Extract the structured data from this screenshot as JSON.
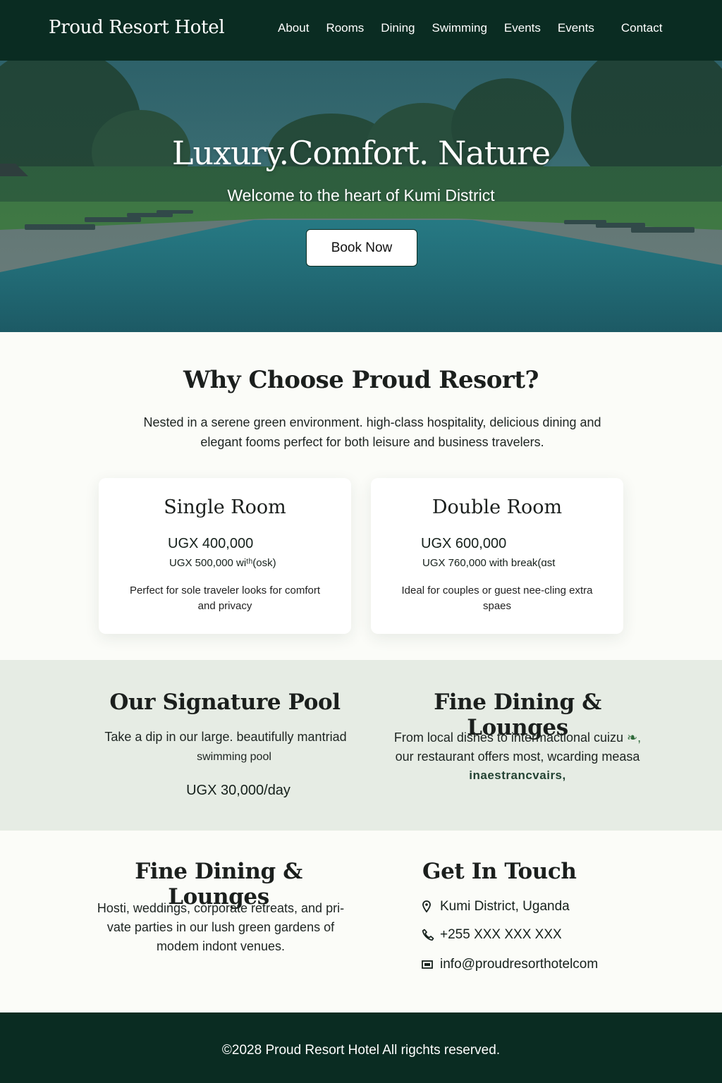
{
  "header": {
    "brand": "Proud Resort Hotel",
    "nav": [
      "About",
      "Rooms",
      "Dining",
      "Swimming",
      "Events",
      "Events",
      "Contact"
    ]
  },
  "hero": {
    "title": "Luxury.Comfort. Nature",
    "subtitle": "Welcome to the heart of Kumi District",
    "cta": "Book Now"
  },
  "why": {
    "title": "Why Choose Proud Resort?",
    "text": "Nested in a serene green environment. high-class hospitality, delicious dining and elegant fooms perfect for both leisure and business travelers."
  },
  "rooms": [
    {
      "name": "Single Room",
      "price": "UGX 400,000",
      "price_alt": "UGX 500,000 wiᵗʰ(osk)",
      "desc": "Perfect for sole traveler looks for comfort and privacy"
    },
    {
      "name": "Double Room",
      "price": "UGX 600,000",
      "price_alt": "UGX 760,000 with break(ɑst",
      "desc": "Ideal for couples or guest nee-cling extra spaes"
    }
  ],
  "pool": {
    "title": "Our Signature Pool",
    "text_line1": "Take a dip in our large. beautifully mantriad",
    "text_line2": "swimming pool",
    "price": "UGX 30,000/day"
  },
  "dining": {
    "title": "Fine Dining & Lounges",
    "text_line1": "From local dishes to intermactional cuizu",
    "text_line2": "our restaurant offers most, wcarding measa",
    "text_line3": "inaestrancvairs,"
  },
  "events": {
    "title": "Fine Dining & Lounges",
    "text": "Hosti, weddings, corporate retreats, and pri-vate parties in our lush green gardens of modem indont venues."
  },
  "contact": {
    "title": "Get In Touch",
    "location": "Kumi District, Uganda",
    "phone": "+255 XXX XXX XXX",
    "email": "info@proudresorthotelcom",
    "icons": [
      "location-pin-icon",
      "phone-icon",
      "mail-icon"
    ]
  },
  "footer": {
    "text": "©2028 Proud Resort Hotel All rigchts reserved."
  },
  "colors": {
    "dark_green": "#0a2c22",
    "pale_green": "#e6ece4",
    "off_white": "#fbfcf8",
    "pool_teal": "#2a6167"
  }
}
